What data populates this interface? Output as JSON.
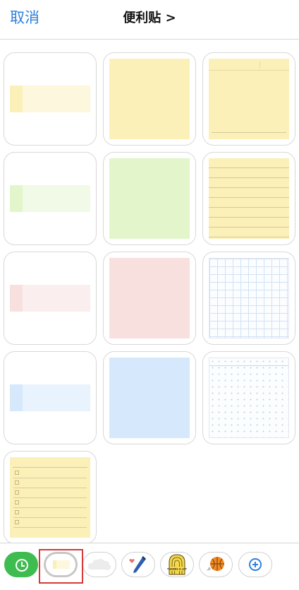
{
  "header": {
    "cancel_label": "取消",
    "title": "便利贴 >"
  },
  "colors": {
    "accent": "#2f7fdc",
    "yellow": "#fbf0b8",
    "yellow_light": "#fdf7dd",
    "green": "#e3f5cb",
    "green_light": "#f1fae6",
    "pink": "#f8e0df",
    "pink_light": "#fbeeee",
    "blue": "#d6e8fb",
    "blue_light": "#e9f3fd",
    "toolbar_recent": "#3ebc4f",
    "selection_highlight": "#d43a3a"
  },
  "templates": [
    {
      "name": "yellow-strip"
    },
    {
      "name": "yellow-square"
    },
    {
      "name": "yellow-lined"
    },
    {
      "name": "green-strip"
    },
    {
      "name": "green-square"
    },
    {
      "name": "yellow-ruled"
    },
    {
      "name": "pink-strip"
    },
    {
      "name": "pink-square"
    },
    {
      "name": "grid"
    },
    {
      "name": "blue-strip"
    },
    {
      "name": "blue-square"
    },
    {
      "name": "dot-grid"
    },
    {
      "name": "checklist"
    }
  ],
  "toolbar": {
    "items": [
      {
        "icon": "clock-icon",
        "state": "default"
      },
      {
        "icon": "sticky-note-icon",
        "state": "selected"
      },
      {
        "icon": "cloud-icon",
        "state": "default"
      },
      {
        "icon": "pen-icon",
        "state": "default"
      },
      {
        "icon": "thanks-badge-icon",
        "state": "default"
      },
      {
        "icon": "basketball-icon",
        "state": "default"
      },
      {
        "icon": "plus-icon",
        "state": "default"
      }
    ],
    "badge_text": "THANKS A LOT"
  }
}
